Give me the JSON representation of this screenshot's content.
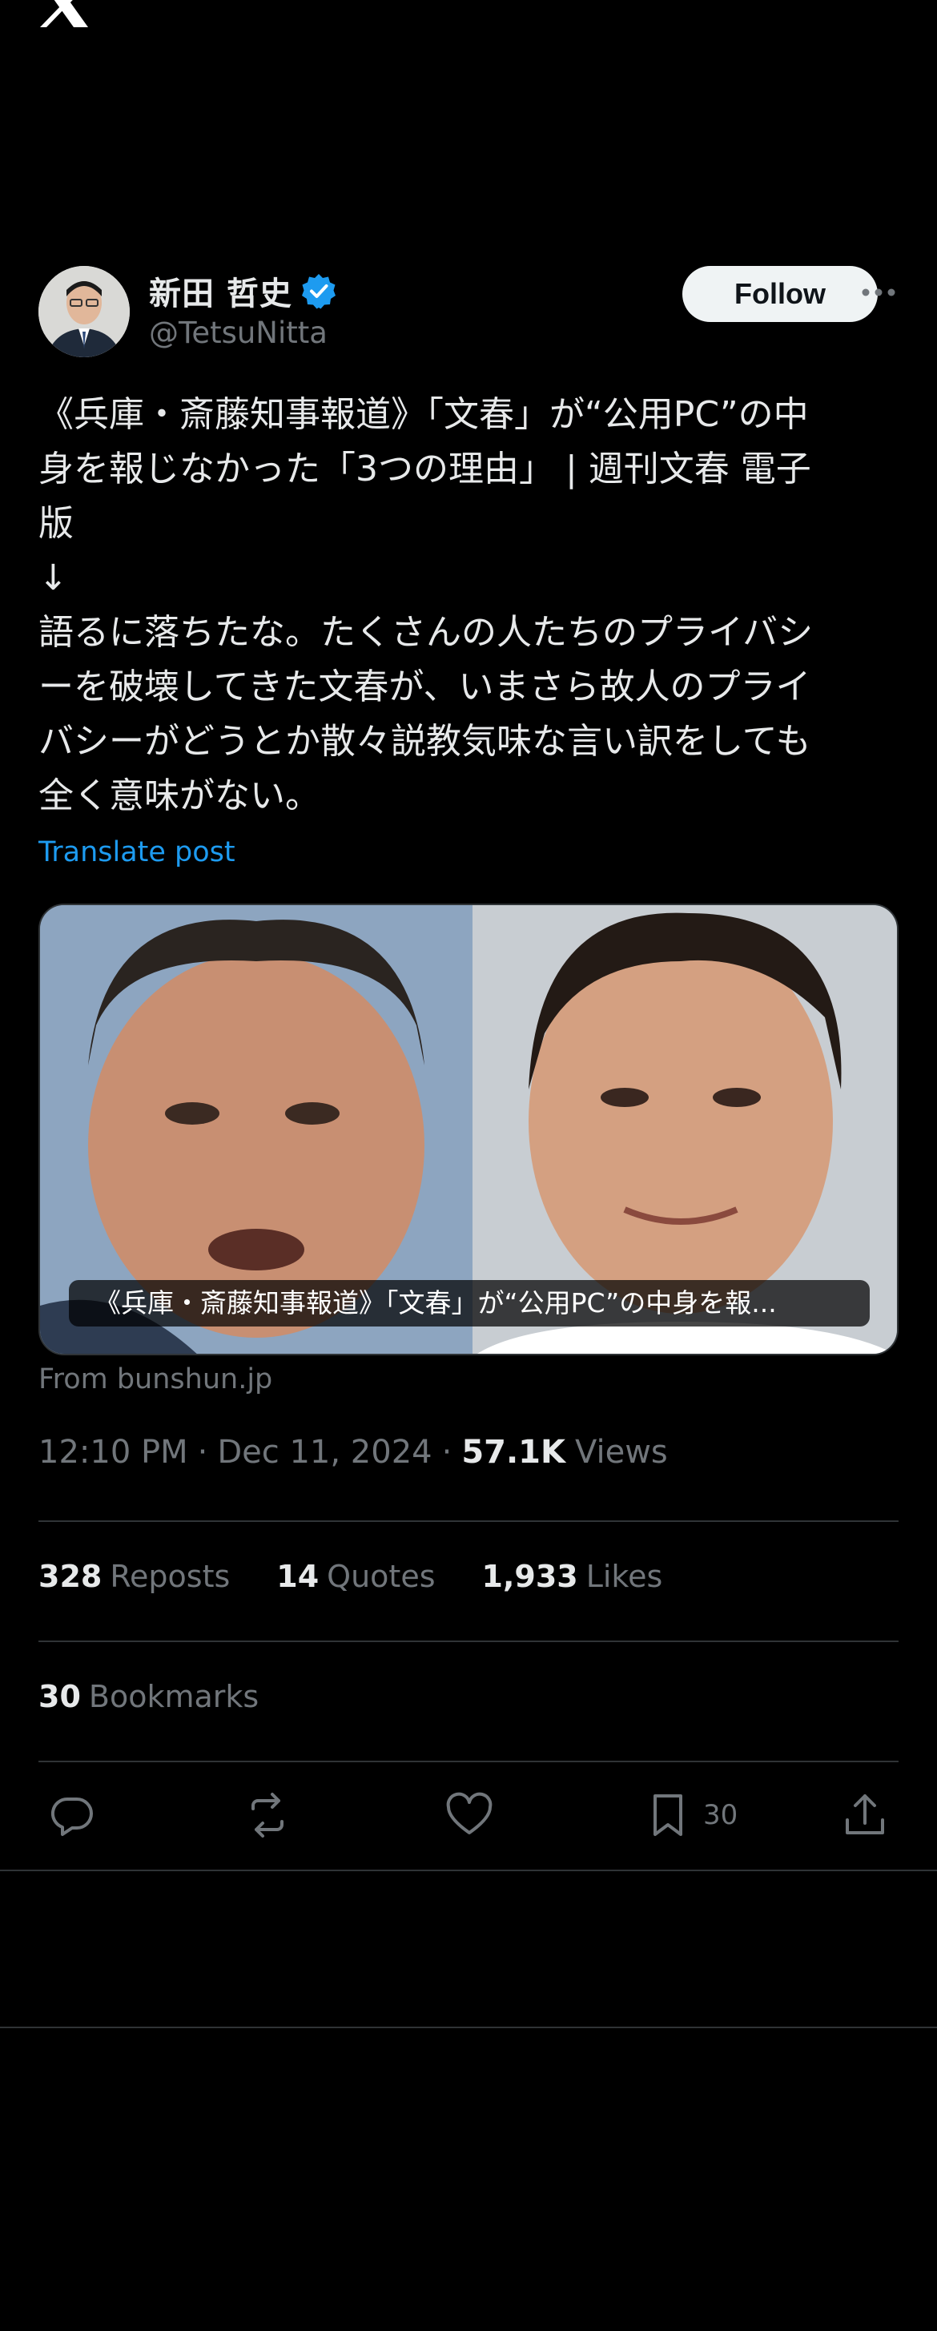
{
  "topbar": {
    "logo_icon": "x-logo-icon",
    "more_icon": "more-horizontal-icon"
  },
  "author": {
    "display_name": "新田 哲史",
    "handle": "@TetsuNitta",
    "verified": true,
    "follow_label": "Follow"
  },
  "post": {
    "text": "《兵庫・斎藤知事報道》「文春」が“公用PC”の中\n身を報じなかった「3つの理由」 | 週刊文春 電子\n版\n↓\n語るに落ちたな。たくさんの人たちのプライバシ\nーを破壊してきた文春が、いまさら故人のプライ\nバシーがどうとか散々説教気味な言い訳をしても\n全く意味がない。",
    "translate_label": "Translate post",
    "card_caption": "《兵庫・斎藤知事報道》「文春」が“公用PC”の中身を報...",
    "card_source": "From bunshun.jp"
  },
  "meta": {
    "time": "12:10 PM",
    "separator": "·",
    "date": "Dec 11, 2024",
    "views_count": "57.1K",
    "views_label": "Views"
  },
  "stats": {
    "reposts_count": "328",
    "reposts_label": "Reposts",
    "quotes_count": "14",
    "quotes_label": "Quotes",
    "likes_count": "1,933",
    "likes_label": "Likes",
    "bookmarks_count": "30",
    "bookmarks_label": "Bookmarks"
  },
  "actions": {
    "reply_icon": "reply-icon",
    "repost_icon": "repost-icon",
    "like_icon": "heart-icon",
    "bookmark_icon": "bookmark-icon",
    "bookmark_count": "30",
    "share_icon": "share-icon"
  },
  "colors": {
    "accent": "#1d9bf0",
    "text": "#e7e9ea",
    "muted": "#71767b",
    "background": "#000000"
  }
}
